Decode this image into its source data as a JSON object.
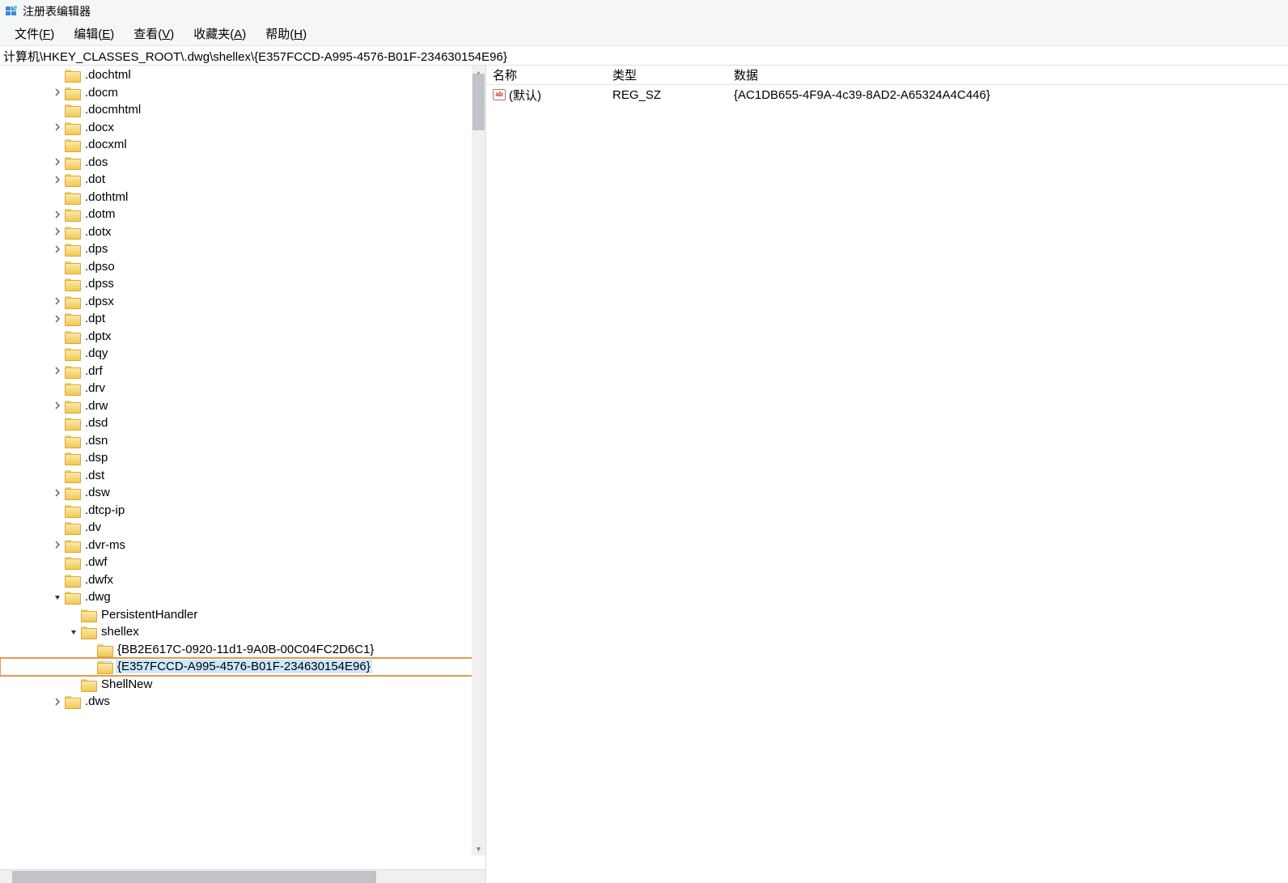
{
  "window": {
    "title": "注册表编辑器"
  },
  "menu": {
    "file": {
      "label": "文件",
      "accel": "F"
    },
    "edit": {
      "label": "编辑",
      "accel": "E"
    },
    "view": {
      "label": "查看",
      "accel": "V"
    },
    "fav": {
      "label": "收藏夹",
      "accel": "A"
    },
    "help": {
      "label": "帮助",
      "accel": "H"
    }
  },
  "address": "计算机\\HKEY_CLASSES_ROOT\\.dwg\\shellex\\{E357FCCD-A995-4576-B01F-234630154E96}",
  "tree": [
    {
      "indent": 2,
      "expand": "none",
      "label": ".dochtml"
    },
    {
      "indent": 2,
      "expand": "closed",
      "label": ".docm"
    },
    {
      "indent": 2,
      "expand": "none",
      "label": ".docmhtml"
    },
    {
      "indent": 2,
      "expand": "closed",
      "label": ".docx"
    },
    {
      "indent": 2,
      "expand": "none",
      "label": ".docxml"
    },
    {
      "indent": 2,
      "expand": "closed",
      "label": ".dos"
    },
    {
      "indent": 2,
      "expand": "closed",
      "label": ".dot"
    },
    {
      "indent": 2,
      "expand": "none",
      "label": ".dothtml"
    },
    {
      "indent": 2,
      "expand": "closed",
      "label": ".dotm"
    },
    {
      "indent": 2,
      "expand": "closed",
      "label": ".dotx"
    },
    {
      "indent": 2,
      "expand": "closed",
      "label": ".dps"
    },
    {
      "indent": 2,
      "expand": "none",
      "label": ".dpso"
    },
    {
      "indent": 2,
      "expand": "none",
      "label": ".dpss"
    },
    {
      "indent": 2,
      "expand": "closed",
      "label": ".dpsx"
    },
    {
      "indent": 2,
      "expand": "closed",
      "label": ".dpt"
    },
    {
      "indent": 2,
      "expand": "none",
      "label": ".dptx"
    },
    {
      "indent": 2,
      "expand": "none",
      "label": ".dqy"
    },
    {
      "indent": 2,
      "expand": "closed",
      "label": ".drf"
    },
    {
      "indent": 2,
      "expand": "none",
      "label": ".drv"
    },
    {
      "indent": 2,
      "expand": "closed",
      "label": ".drw"
    },
    {
      "indent": 2,
      "expand": "none",
      "label": ".dsd"
    },
    {
      "indent": 2,
      "expand": "none",
      "label": ".dsn"
    },
    {
      "indent": 2,
      "expand": "none",
      "label": ".dsp"
    },
    {
      "indent": 2,
      "expand": "none",
      "label": ".dst"
    },
    {
      "indent": 2,
      "expand": "closed",
      "label": ".dsw"
    },
    {
      "indent": 2,
      "expand": "none",
      "label": ".dtcp-ip"
    },
    {
      "indent": 2,
      "expand": "none",
      "label": ".dv"
    },
    {
      "indent": 2,
      "expand": "closed",
      "label": ".dvr-ms"
    },
    {
      "indent": 2,
      "expand": "none",
      "label": ".dwf"
    },
    {
      "indent": 2,
      "expand": "none",
      "label": ".dwfx"
    },
    {
      "indent": 2,
      "expand": "open",
      "label": ".dwg"
    },
    {
      "indent": 3,
      "expand": "none",
      "label": "PersistentHandler"
    },
    {
      "indent": 3,
      "expand": "open",
      "label": "shellex"
    },
    {
      "indent": 4,
      "expand": "none",
      "label": "{BB2E617C-0920-11d1-9A0B-00C04FC2D6C1}"
    },
    {
      "indent": 4,
      "expand": "none",
      "label": "{E357FCCD-A995-4576-B01F-234630154E96}",
      "selected": true
    },
    {
      "indent": 3,
      "expand": "none",
      "label": "ShellNew"
    },
    {
      "indent": 2,
      "expand": "closed",
      "label": ".dws"
    }
  ],
  "list": {
    "columns": {
      "name": "名称",
      "type": "类型",
      "data": "数据"
    },
    "rows": [
      {
        "name": "(默认)",
        "icon": "string",
        "type": "REG_SZ",
        "data": "{AC1DB655-4F9A-4c39-8AD2-A65324A4C446}"
      }
    ]
  }
}
